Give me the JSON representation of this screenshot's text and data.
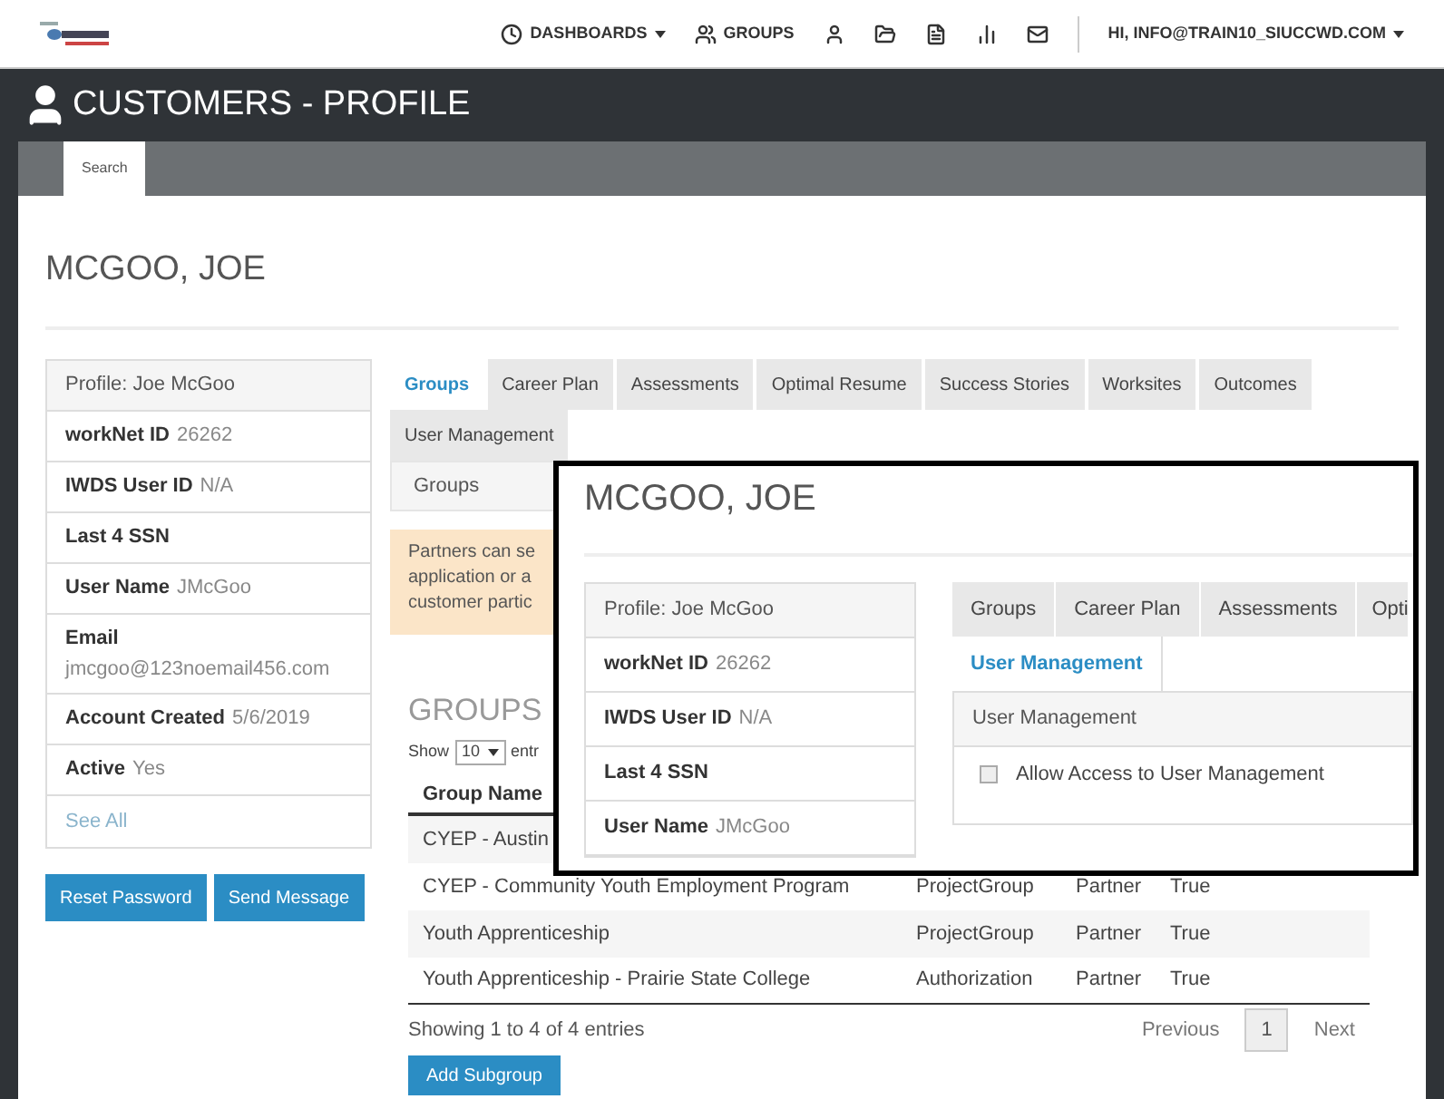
{
  "nav": {
    "items": [
      {
        "kind": "dropdown",
        "label": "DASHBOARDS"
      },
      {
        "kind": "link",
        "label": "GROUPS"
      },
      {
        "kind": "icon"
      },
      {
        "kind": "icon"
      },
      {
        "kind": "icon"
      },
      {
        "kind": "icon"
      },
      {
        "kind": "icon"
      }
    ],
    "user": "HI, INFO@TRAIN10_SIUCCWD.COM"
  },
  "page_title": "CUSTOMERS - PROFILE",
  "subnav": [
    {
      "label": "Search",
      "selected": true
    }
  ],
  "customer_name": "MCGOO, JOE",
  "profile": [
    {
      "kind": "header",
      "label": "Profile: Joe McGoo"
    },
    {
      "kind": "field",
      "label": "workNet ID",
      "value": "26262"
    },
    {
      "kind": "field",
      "label": "IWDS User ID",
      "value": "N/A"
    },
    {
      "kind": "field",
      "label": "Last 4 SSN"
    },
    {
      "kind": "field",
      "label": "User Name",
      "value": "JMcGoo"
    },
    {
      "kind": "stacked",
      "label": "Email",
      "value": "jmcgoo@123noemail456.com"
    },
    {
      "kind": "field",
      "label": "Account Created",
      "value": "5/6/2019"
    },
    {
      "kind": "field",
      "label": "Active",
      "value": "Yes"
    },
    {
      "kind": "link",
      "label": "See All"
    }
  ],
  "buttons": [
    "Reset Password",
    "Send Message"
  ],
  "tabs": [
    {
      "label": "Groups",
      "selected": true
    },
    {
      "label": "Career Plan",
      "selected": false
    },
    {
      "label": "Assessments",
      "selected": false
    },
    {
      "label": "Optimal Resume",
      "selected": false
    },
    {
      "label": "Success Stories",
      "selected": false
    },
    {
      "label": "Worksites",
      "selected": false
    },
    {
      "label": "Outcomes",
      "selected": false
    },
    {
      "label": "User Management",
      "selected": false
    }
  ],
  "section_title": "Groups",
  "alert": [
    "Partners can se",
    "application or a",
    "customer partic"
  ],
  "groups": {
    "heading": "GROUPS",
    "show": "Show",
    "page_size": "10",
    "entries": "entr",
    "columns": [
      "Group Name"
    ],
    "rows": [
      [
        "CYEP - Austin"
      ],
      [
        "CYEP - Community Youth Employment Program",
        "ProjectGroup",
        "Partner",
        "True"
      ],
      [
        "Youth Apprenticeship",
        "ProjectGroup",
        "Partner",
        "True"
      ],
      [
        "Youth Apprenticeship - Prairie State College",
        "Authorization",
        "Partner",
        "True"
      ]
    ],
    "info": "Showing 1 to 4 of 4 entries",
    "pagination": [
      {
        "label": "Previous",
        "selected": false
      },
      {
        "label": "1",
        "selected": true
      },
      {
        "label": "Next",
        "selected": false
      }
    ],
    "add_button": "Add Subgroup"
  },
  "inset": {
    "customer_name": "MCGOO, JOE",
    "profile": [
      {
        "kind": "header",
        "label": "Profile: Joe McGoo"
      },
      {
        "kind": "field",
        "label": "workNet ID",
        "value": "26262"
      },
      {
        "kind": "field",
        "label": "IWDS User ID",
        "value": "N/A"
      },
      {
        "kind": "field",
        "label": "Last 4 SSN"
      },
      {
        "kind": "field",
        "label": "User Name",
        "value": "JMcGoo"
      }
    ],
    "tabs": [
      {
        "label": "Groups",
        "selected": false
      },
      {
        "label": "Career Plan",
        "selected": false
      },
      {
        "label": "Assessments",
        "selected": false
      },
      {
        "label": "Opti",
        "selected": false
      },
      {
        "label": "User Management",
        "selected": true
      }
    ],
    "panel_title": "User Management",
    "checkbox": {
      "label": "Allow Access to User Management",
      "checked": false
    }
  }
}
